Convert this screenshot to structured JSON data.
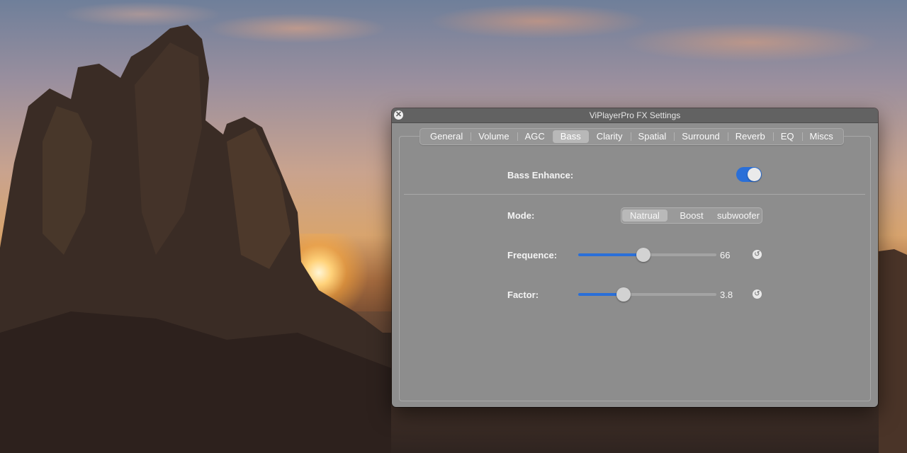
{
  "window": {
    "title": "ViPlayerPro FX Settings"
  },
  "tabs": [
    {
      "label": "General"
    },
    {
      "label": "Volume"
    },
    {
      "label": "AGC"
    },
    {
      "label": "Bass",
      "active": true
    },
    {
      "label": "Clarity"
    },
    {
      "label": "Spatial"
    },
    {
      "label": "Surround"
    },
    {
      "label": "Reverb"
    },
    {
      "label": "EQ"
    },
    {
      "label": "Miscs"
    }
  ],
  "bass": {
    "enhance_label": "Bass Enhance:",
    "enhance_on": true,
    "mode_label": "Mode:",
    "modes": [
      "Natrual",
      "Boost",
      "subwoofer"
    ],
    "selected_mode": "Natrual",
    "frequence_label": "Frequence:",
    "frequence_value": "66",
    "frequence_fraction": 0.47,
    "factor_label": "Factor:",
    "factor_value": "3.8",
    "factor_fraction": 0.33
  },
  "colors": {
    "accent": "#2a6fd8",
    "window_bg": "#8e8e8e",
    "titlebar_bg": "#626262"
  },
  "icons": {
    "close": "close-icon",
    "reset": "reset-icon"
  }
}
